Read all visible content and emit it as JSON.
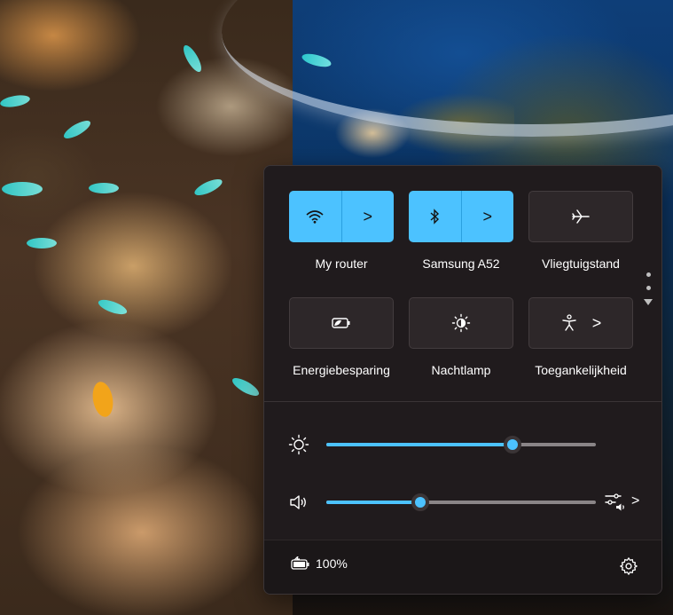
{
  "flyout": {
    "tiles": [
      {
        "label": "My router",
        "icon": "wifi-icon",
        "state": "on",
        "has_chevron": true
      },
      {
        "label": "Samsung A52",
        "icon": "bluetooth-icon",
        "state": "on",
        "has_chevron": true
      },
      {
        "label": "Vliegtuigstand",
        "icon": "airplane-icon",
        "state": "off",
        "has_chevron": false
      },
      {
        "label": "Energiebesparing",
        "icon": "battery-saver-icon",
        "state": "off",
        "has_chevron": false
      },
      {
        "label": "Nachtlamp",
        "icon": "night-light-icon",
        "state": "off",
        "has_chevron": false
      },
      {
        "label": "Toegankelijkheid",
        "icon": "accessibility-icon",
        "state": "off",
        "has_chevron": true
      }
    ],
    "chevron_glyph": ">",
    "brightness": {
      "icon": "brightness-icon",
      "level": 0.69
    },
    "volume": {
      "icon": "speaker-icon",
      "level": 0.35,
      "extra_icon": "audio-output-icon"
    },
    "battery": {
      "icon": "battery-icon",
      "percent": "100%"
    },
    "settings_icon": "gear-icon"
  },
  "colors": {
    "accent": "#4cc2ff",
    "panel": "#201b1d",
    "tile_off": "#2d2729"
  }
}
